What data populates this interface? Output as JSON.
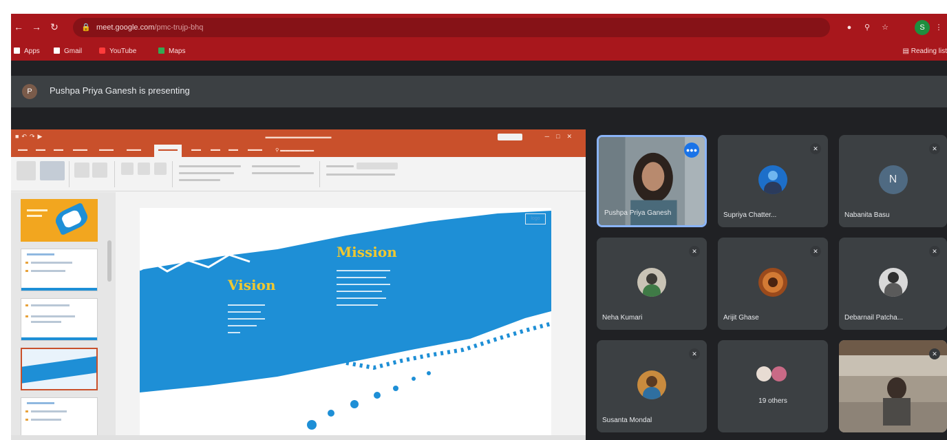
{
  "browser": {
    "url_host": "meet.google.com",
    "url_path": "/pmc-trujp-bhq",
    "profile_initial": "S",
    "bookmarks": [
      {
        "label": "Apps"
      },
      {
        "label": "Gmail"
      },
      {
        "label": "YouTube"
      },
      {
        "label": "Maps"
      }
    ],
    "reading_list": "Reading list"
  },
  "meet": {
    "presenter_initial": "P",
    "presenter_text": "Pushpa Priya Ganesh is presenting"
  },
  "slide": {
    "heading_vision": "Vision",
    "heading_mission": "Mission",
    "logo": "logo"
  },
  "participants": [
    {
      "name": "Pushpa Priya Ganesh",
      "speaking": true,
      "type": "video"
    },
    {
      "name": "Supriya Chatter...",
      "type": "avatar",
      "muted": true
    },
    {
      "name": "Nabanita Basu",
      "type": "letter",
      "initial": "N",
      "muted": true
    },
    {
      "name": "Neha Kumari",
      "type": "avatar",
      "muted": true
    },
    {
      "name": "Arijit Ghase",
      "type": "avatar",
      "muted": true
    },
    {
      "name": "Debarnail Patcha...",
      "type": "avatar",
      "muted": true
    },
    {
      "name": "Susanta Mondal",
      "type": "avatar",
      "muted": true
    },
    {
      "name": "19 others",
      "type": "group"
    },
    {
      "name": "",
      "type": "video",
      "muted": true
    }
  ],
  "colors": {
    "chrome_red": "#a8171c",
    "ppt_orange": "#c9502b",
    "slide_blue": "#1e8fd6",
    "meet_tile": "#3c4043",
    "speaking_blue": "#1a73e8"
  }
}
